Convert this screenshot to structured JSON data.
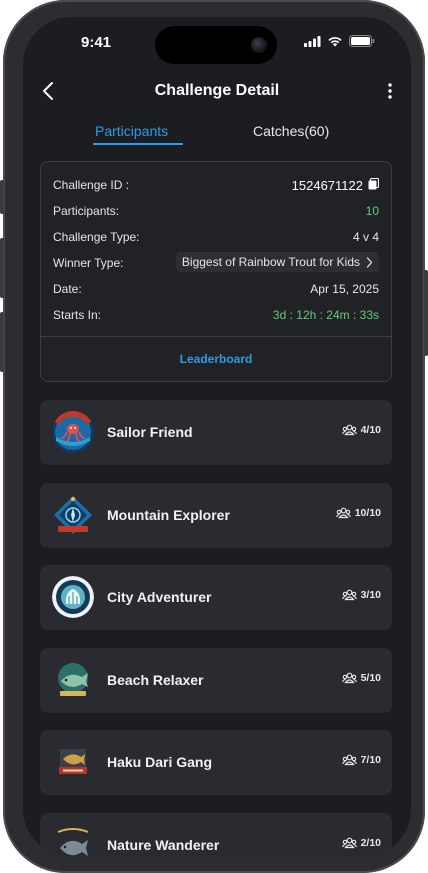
{
  "status": {
    "time": "9:41"
  },
  "header": {
    "title": "Challenge Detail"
  },
  "tabs": [
    {
      "label": "Participants",
      "active": true
    },
    {
      "label": "Catches(60)",
      "active": false
    }
  ],
  "challenge": {
    "id_label": "Challenge ID :",
    "id_value": "1524671122",
    "participants_label": "Participants:",
    "participants_value": "10",
    "type_label": "Challenge Type:",
    "type_value": "4 v 4",
    "winner_label": "Winner Type:",
    "winner_value": "Biggest of Rainbow Trout for Kids",
    "date_label": "Date:",
    "date_value": "Apr 15, 2025",
    "starts_label": "Starts In:",
    "starts_value": "3d : 12h : 24m : 33s",
    "leaderboard_label": "Leaderboard"
  },
  "teams": [
    {
      "name": "Sailor Friend",
      "count": "4/10"
    },
    {
      "name": "Mountain Explorer",
      "count": "10/10"
    },
    {
      "name": "City Adventurer",
      "count": "3/10"
    },
    {
      "name": "Beach Relaxer",
      "count": "5/10"
    },
    {
      "name": "Haku Dari Gang",
      "count": "7/10"
    },
    {
      "name": "Nature Wanderer",
      "count": "2/10"
    }
  ],
  "colors": {
    "accent": "#2d9be6",
    "success": "#5fce7b",
    "background": "#1c1d20",
    "card": "#2a2b30"
  }
}
